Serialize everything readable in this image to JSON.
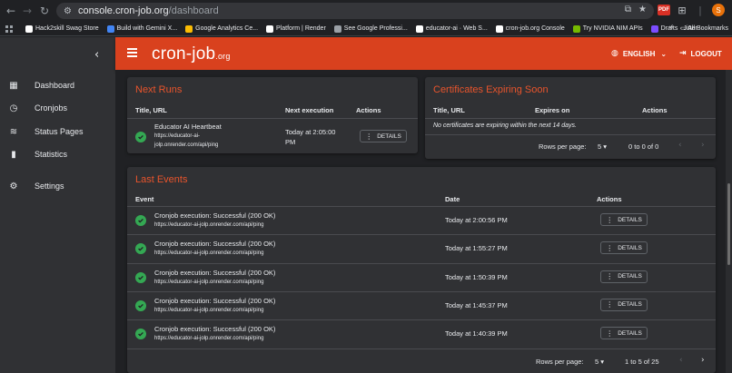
{
  "browser": {
    "url_host": "console.cron-job.org",
    "url_path": "/dashboard",
    "bookmarks": [
      {
        "label": "Hack2skill Swag Store",
        "color": "#ffffff"
      },
      {
        "label": "Build with Gemini X...",
        "color": "#4285f4"
      },
      {
        "label": "Google Analytics Ce...",
        "color": "#fbbc04"
      },
      {
        "label": "Platform | Render",
        "color": "#ffffff"
      },
      {
        "label": "See Google Professi...",
        "color": "#9aa0a6"
      },
      {
        "label": "educator-ai · Web S...",
        "color": "#ffffff"
      },
      {
        "label": "cron-job.org Console",
        "color": "#ffffff"
      },
      {
        "label": "Try NVIDIA NIM APIs",
        "color": "#76b900"
      },
      {
        "label": "Drafts · Jitter",
        "color": "#7c4dff"
      }
    ],
    "more_label": "»",
    "all_bookmarks": "All Bookmarks",
    "pdf_label": "PDF",
    "avatar_letter": "S"
  },
  "sidebar": {
    "items": [
      {
        "label": "Dashboard",
        "icon": "dashboard-icon"
      },
      {
        "label": "Cronjobs",
        "icon": "clock-icon"
      },
      {
        "label": "Status Pages",
        "icon": "wifi-icon"
      },
      {
        "label": "Statistics",
        "icon": "bar-chart-icon"
      },
      {
        "label": "Settings",
        "icon": "gear-icon"
      }
    ]
  },
  "appbar": {
    "logo_main": "cron-job",
    "logo_tld": ".org",
    "language": "ENGLISH",
    "logout": "LOGOUT",
    "accent": "#d9411e"
  },
  "next_runs": {
    "title": "Next Runs",
    "headers": [
      "Title, URL",
      "Next execution",
      "Actions"
    ],
    "rows": [
      {
        "title": "Educator AI Heartbeat",
        "url_line1": "https://educator-ai-",
        "url_line2": "jolp.onrender.com/api/ping",
        "next_line1": "Today at 2:05:00",
        "next_line2": "PM",
        "action": "DETAILS"
      }
    ]
  },
  "certificates": {
    "title": "Certificates Expiring Soon",
    "headers": [
      "Title, URL",
      "Expires on",
      "Actions"
    ],
    "empty_text": "No certificates are expiring within the next 14 days.",
    "rows_per_page_label": "Rows per page:",
    "rows_per_page": "5",
    "range": "0 to 0 of 0"
  },
  "last_events": {
    "title": "Last Events",
    "headers": [
      "Event",
      "Date",
      "Actions"
    ],
    "rows": [
      {
        "event": "Cronjob execution: Successful (200 OK)",
        "url": "https://educator-ai-jolp.onrender.com/api/ping",
        "date": "Today at 2:00:56 PM",
        "action": "DETAILS"
      },
      {
        "event": "Cronjob execution: Successful (200 OK)",
        "url": "https://educator-ai-jolp.onrender.com/api/ping",
        "date": "Today at 1:55:27 PM",
        "action": "DETAILS"
      },
      {
        "event": "Cronjob execution: Successful (200 OK)",
        "url": "https://educator-ai-jolp.onrender.com/api/ping",
        "date": "Today at 1:50:39 PM",
        "action": "DETAILS"
      },
      {
        "event": "Cronjob execution: Successful (200 OK)",
        "url": "https://educator-ai-jolp.onrender.com/api/ping",
        "date": "Today at 1:45:37 PM",
        "action": "DETAILS"
      },
      {
        "event": "Cronjob execution: Successful (200 OK)",
        "url": "https://educator-ai-jolp.onrender.com/api/ping",
        "date": "Today at 1:40:39 PM",
        "action": "DETAILS"
      }
    ],
    "rows_per_page_label": "Rows per page:",
    "rows_per_page": "5",
    "range": "1 to 5 of 25"
  },
  "colors": {
    "title_accent": "#e8542c",
    "success": "#34a853"
  }
}
